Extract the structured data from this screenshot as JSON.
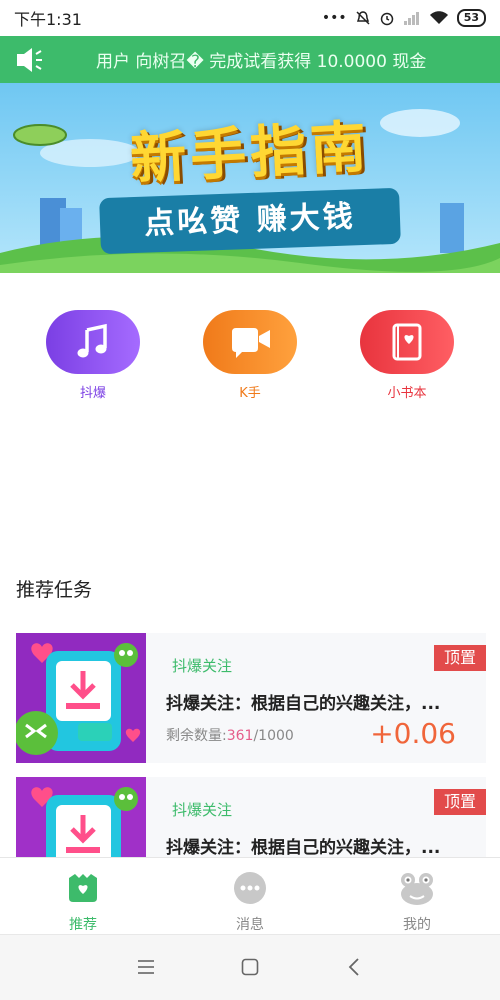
{
  "status_bar": {
    "time": "下午1:31",
    "battery": "53",
    "icons": [
      "more-icon",
      "mute-icon",
      "alarm-icon",
      "signal-icon",
      "wifi-icon",
      "battery-icon"
    ]
  },
  "notice": {
    "text": "用户 向树召� 完成试看获得 10.0000 现金",
    "icon": "speaker-icon"
  },
  "banner": {
    "title": "新手指南",
    "subtitle": "点吆赞 赚大钱"
  },
  "apps": [
    {
      "label": "抖爆",
      "icon": "music-note-icon",
      "color": "#7b3fe4"
    },
    {
      "label": "K手",
      "icon": "video-camera-icon",
      "color": "#f07a1a"
    },
    {
      "label": "小书本",
      "icon": "book-icon",
      "color": "#e8343e"
    }
  ],
  "section_title": "推荐任务",
  "tasks": [
    {
      "tag": "抖爆关注",
      "pin": "顶置",
      "title": "抖爆关注：根据自己的兴趣关注，...",
      "remain_label": "剩余数量:",
      "remain_done": "361",
      "remain_total": "/1000",
      "reward": "+0.06"
    },
    {
      "tag": "抖爆关注",
      "pin": "顶置",
      "title": "抖爆关注：根据自己的兴趣关注，..."
    }
  ],
  "tabbar": {
    "items": [
      {
        "label": "推荐",
        "icon": "recommend-icon",
        "active": true
      },
      {
        "label": "消息",
        "icon": "message-icon",
        "active": false
      },
      {
        "label": "我的",
        "icon": "frog-profile-icon",
        "active": false
      }
    ],
    "active_color": "#3dbb6b"
  },
  "system_nav": [
    "menu-icon",
    "home-icon",
    "back-icon"
  ]
}
